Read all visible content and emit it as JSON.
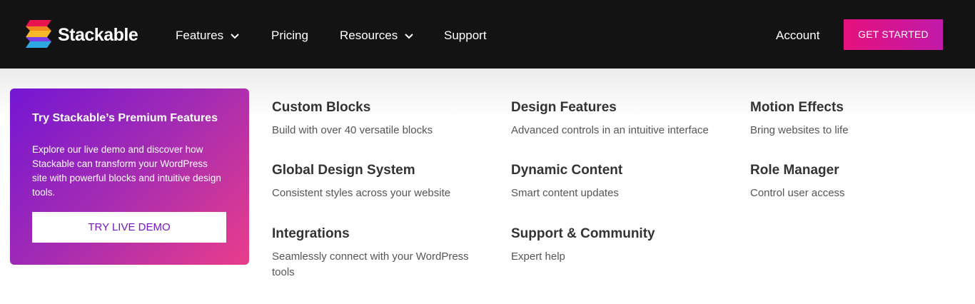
{
  "header": {
    "brand": "Stackable",
    "nav": {
      "features": "Features",
      "pricing": "Pricing",
      "resources": "Resources",
      "support": "Support"
    },
    "account": "Account",
    "cta": "GET STARTED"
  },
  "colors": {
    "topbar": "#131313",
    "accent_pink": "#e5117d",
    "accent_purple": "#7416d3"
  },
  "icons": {
    "logo": "stackable-logo",
    "chevron": "chevron-down-icon"
  },
  "promo": {
    "title": "Try Stackable’s Premium Features",
    "body": "Explore our live demo and discover how Stackable can transform your WordPress site with powerful blocks and intuitive design tools.",
    "button": "TRY LIVE DEMO"
  },
  "features": [
    {
      "title": "Custom Blocks",
      "desc": "Build with over 40 versatile blocks"
    },
    {
      "title": "Design Features",
      "desc": "Advanced controls in an intuitive interface"
    },
    {
      "title": "Motion Effects",
      "desc": "Bring websites to life"
    },
    {
      "title": "Global Design System",
      "desc": "Consistent styles across your website"
    },
    {
      "title": "Dynamic Content",
      "desc": "Smart content updates"
    },
    {
      "title": "Role Manager",
      "desc": "Control user access"
    },
    {
      "title": "Integrations",
      "desc": "Seamlessly connect with your WordPress tools"
    },
    {
      "title": "Support & Community",
      "desc": "Expert help"
    }
  ]
}
